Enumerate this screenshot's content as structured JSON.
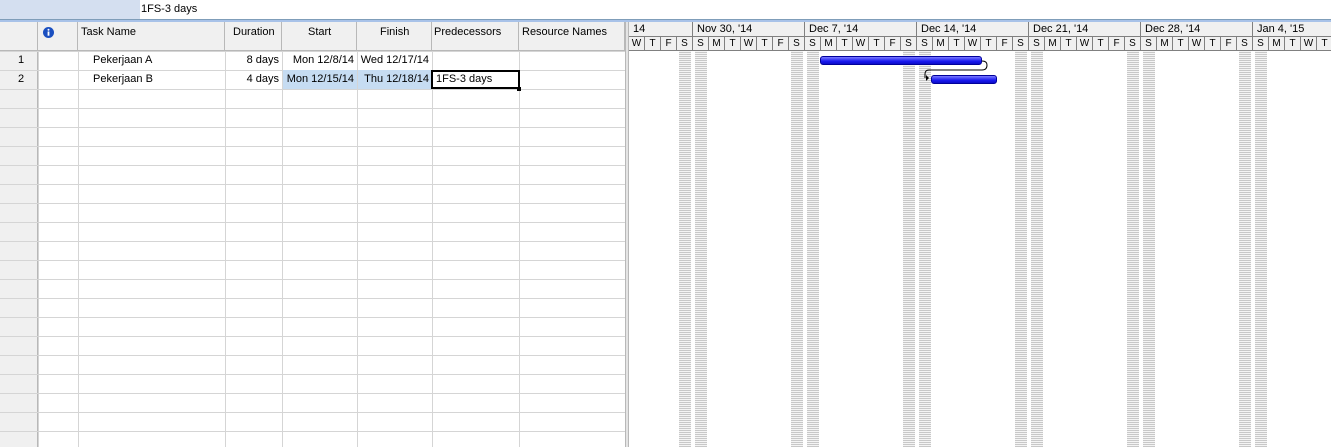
{
  "entry_bar": {
    "value": "1FS-3 days"
  },
  "columns": {
    "info_icon": "info-icon",
    "task_name": "Task Name",
    "duration": "Duration",
    "start": "Start",
    "finish": "Finish",
    "predecessors": "Predecessors",
    "resource_names": "Resource Names"
  },
  "tasks": [
    {
      "id": "1",
      "name": "Pekerjaan A",
      "duration": "8 days",
      "start": "Mon 12/8/14",
      "finish": "Wed 12/17/14",
      "predecessors": "",
      "resources": ""
    },
    {
      "id": "2",
      "name": "Pekerjaan B",
      "duration": "4 days",
      "start": "Mon 12/15/14",
      "finish": "Thu 12/18/14",
      "predecessors": "1FS-3 days",
      "resources": ""
    }
  ],
  "timescale": {
    "weeks": [
      "14",
      "Nov 30, '14",
      "Dec 7, '14",
      "Dec 14, '14",
      "Dec 21, '14",
      "Dec 28, '14",
      "Jan 4, '15"
    ],
    "first_week_days": [
      "W",
      "T",
      "F",
      "S"
    ],
    "week_days": [
      "S",
      "M",
      "T",
      "W",
      "T",
      "F",
      "S"
    ]
  },
  "colors": {
    "bar": "#1a1af0",
    "selection": "#c6dcf2",
    "accent": "#4a7fc9"
  }
}
